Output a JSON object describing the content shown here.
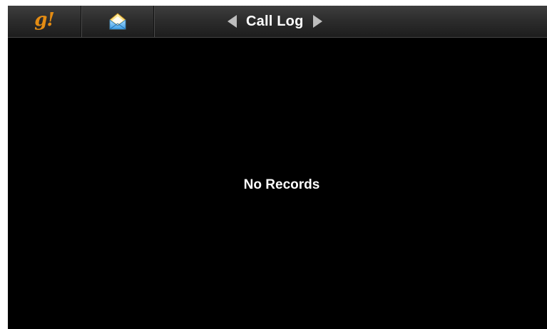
{
  "header": {
    "logo_text": "g!",
    "title": "Call Log"
  },
  "icons": {
    "logo": "g-logo-icon",
    "messages": "envelope-icon",
    "prev": "triangle-left-icon",
    "next": "triangle-right-icon"
  },
  "content": {
    "empty_message": "No Records"
  },
  "colors": {
    "logo": "#e48c13",
    "background": "#000000",
    "text": "#ffffff",
    "arrow": "#bdbdbd"
  }
}
